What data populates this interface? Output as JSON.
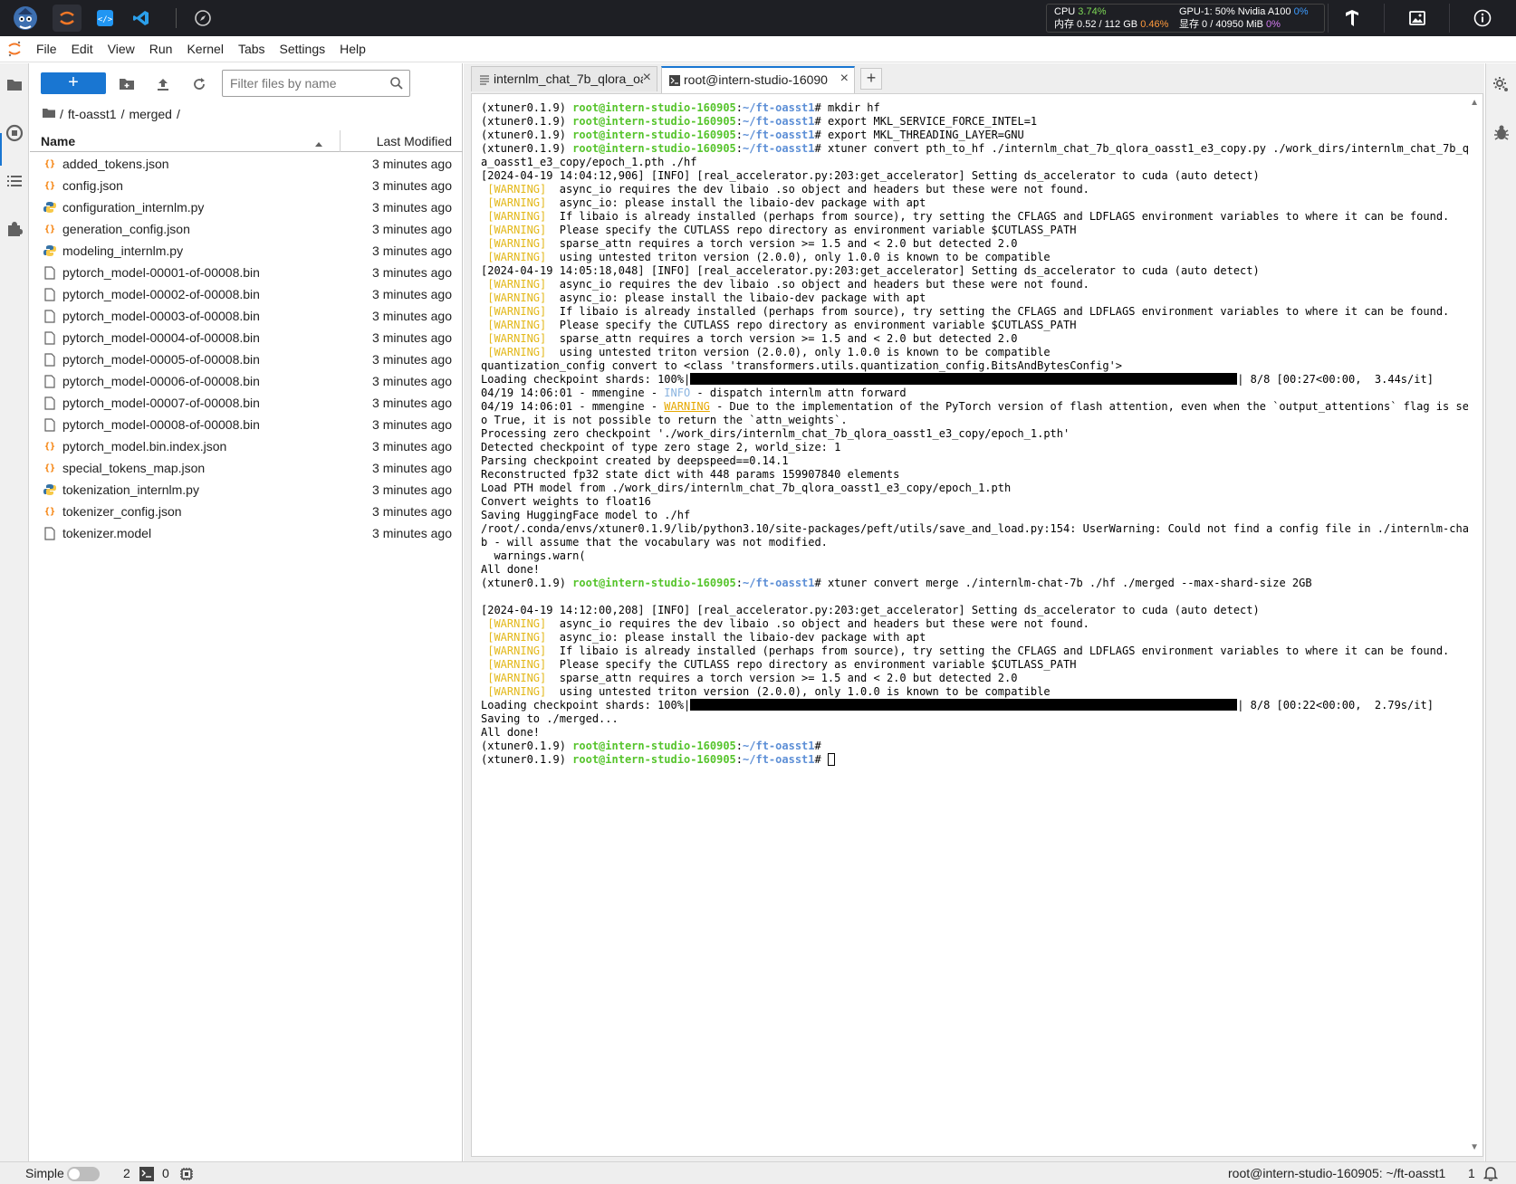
{
  "topbar": {
    "cpu_label": "CPU",
    "cpu_value": "3.74%",
    "mem_label": "内存 0.52 / 112 GB",
    "mem_value": "0.46%",
    "gpu_label": "GPU-1: 50% Nvidia A100",
    "gpu_value": "0%",
    "vram_label": "显存 0 / 40950 MiB",
    "vram_value": "0%"
  },
  "menu": [
    "File",
    "Edit",
    "View",
    "Run",
    "Kernel",
    "Tabs",
    "Settings",
    "Help"
  ],
  "filebrowser": {
    "new_button": "+",
    "filter_placeholder": "Filter files by name",
    "breadcrumb": [
      "/",
      "ft-oasst1",
      "/",
      "merged",
      "/"
    ],
    "col_name": "Name",
    "col_modified": "Last Modified",
    "files": [
      {
        "name": "added_tokens.json",
        "type": "json",
        "modified": "3 minutes ago"
      },
      {
        "name": "config.json",
        "type": "json",
        "modified": "3 minutes ago"
      },
      {
        "name": "configuration_internlm.py",
        "type": "py",
        "modified": "3 minutes ago"
      },
      {
        "name": "generation_config.json",
        "type": "json",
        "modified": "3 minutes ago"
      },
      {
        "name": "modeling_internlm.py",
        "type": "py",
        "modified": "3 minutes ago"
      },
      {
        "name": "pytorch_model-00001-of-00008.bin",
        "type": "file",
        "modified": "3 minutes ago"
      },
      {
        "name": "pytorch_model-00002-of-00008.bin",
        "type": "file",
        "modified": "3 minutes ago"
      },
      {
        "name": "pytorch_model-00003-of-00008.bin",
        "type": "file",
        "modified": "3 minutes ago"
      },
      {
        "name": "pytorch_model-00004-of-00008.bin",
        "type": "file",
        "modified": "3 minutes ago"
      },
      {
        "name": "pytorch_model-00005-of-00008.bin",
        "type": "file",
        "modified": "3 minutes ago"
      },
      {
        "name": "pytorch_model-00006-of-00008.bin",
        "type": "file",
        "modified": "3 minutes ago"
      },
      {
        "name": "pytorch_model-00007-of-00008.bin",
        "type": "file",
        "modified": "3 minutes ago"
      },
      {
        "name": "pytorch_model-00008-of-00008.bin",
        "type": "file",
        "modified": "3 minutes ago"
      },
      {
        "name": "pytorch_model.bin.index.json",
        "type": "json",
        "modified": "3 minutes ago"
      },
      {
        "name": "special_tokens_map.json",
        "type": "json",
        "modified": "3 minutes ago"
      },
      {
        "name": "tokenization_internlm.py",
        "type": "py",
        "modified": "3 minutes ago"
      },
      {
        "name": "tokenizer_config.json",
        "type": "json",
        "modified": "3 minutes ago"
      },
      {
        "name": "tokenizer.model",
        "type": "file",
        "modified": "3 minutes ago"
      }
    ]
  },
  "tabs": [
    {
      "label": "internlm_chat_7b_qlora_oa",
      "close": "×",
      "active": false
    },
    {
      "label": "root@intern-studio-16090",
      "close": "×",
      "active": true
    }
  ],
  "tab_add": "+",
  "terminal": {
    "lines": [
      [
        {
          "t": "(xtuner0.1.9) "
        },
        {
          "t": "root@intern-studio-160905",
          "c": "g"
        },
        {
          "t": ":"
        },
        {
          "t": "~/ft-oasst1",
          "c": "b"
        },
        {
          "t": "# mkdir hf"
        }
      ],
      [
        {
          "t": "(xtuner0.1.9) "
        },
        {
          "t": "root@intern-studio-160905",
          "c": "g"
        },
        {
          "t": ":"
        },
        {
          "t": "~/ft-oasst1",
          "c": "b"
        },
        {
          "t": "# export MKL_SERVICE_FORCE_INTEL=1"
        }
      ],
      [
        {
          "t": "(xtuner0.1.9) "
        },
        {
          "t": "root@intern-studio-160905",
          "c": "g"
        },
        {
          "t": ":"
        },
        {
          "t": "~/ft-oasst1",
          "c": "b"
        },
        {
          "t": "# export MKL_THREADING_LAYER=GNU"
        }
      ],
      [
        {
          "t": "(xtuner0.1.9) "
        },
        {
          "t": "root@intern-studio-160905",
          "c": "g"
        },
        {
          "t": ":"
        },
        {
          "t": "~/ft-oasst1",
          "c": "b"
        },
        {
          "t": "# xtuner convert pth_to_hf ./internlm_chat_7b_qlora_oasst1_e3_copy.py ./work_dirs/internlm_chat_7b_qlor"
        }
      ],
      [
        {
          "t": "a_oasst1_e3_copy/epoch_1.pth ./hf"
        }
      ],
      [
        {
          "t": "[2024-04-19 14:04:12,906] [INFO] [real_accelerator.py:203:get_accelerator] Setting ds_accelerator to cuda (auto detect)"
        }
      ],
      [
        {
          "t": " "
        },
        {
          "t": "[WARNING]",
          "c": "w"
        },
        {
          "t": "  async_io requires the dev libaio .so object and headers but these were not found."
        }
      ],
      [
        {
          "t": " "
        },
        {
          "t": "[WARNING]",
          "c": "w"
        },
        {
          "t": "  async_io: please install the libaio-dev package with apt"
        }
      ],
      [
        {
          "t": " "
        },
        {
          "t": "[WARNING]",
          "c": "w"
        },
        {
          "t": "  If libaio is already installed (perhaps from source), try setting the CFLAGS and LDFLAGS environment variables to where it can be found."
        }
      ],
      [
        {
          "t": " "
        },
        {
          "t": "[WARNING]",
          "c": "w"
        },
        {
          "t": "  Please specify the CUTLASS repo directory as environment variable $CUTLASS_PATH"
        }
      ],
      [
        {
          "t": " "
        },
        {
          "t": "[WARNING]",
          "c": "w"
        },
        {
          "t": "  sparse_attn requires a torch version >= 1.5 and < 2.0 but detected 2.0"
        }
      ],
      [
        {
          "t": " "
        },
        {
          "t": "[WARNING]",
          "c": "w"
        },
        {
          "t": "  using untested triton version (2.0.0), only 1.0.0 is known to be compatible"
        }
      ],
      [
        {
          "t": "[2024-04-19 14:05:18,048] [INFO] [real_accelerator.py:203:get_accelerator] Setting ds_accelerator to cuda (auto detect)"
        }
      ],
      [
        {
          "t": " "
        },
        {
          "t": "[WARNING]",
          "c": "w"
        },
        {
          "t": "  async_io requires the dev libaio .so object and headers but these were not found."
        }
      ],
      [
        {
          "t": " "
        },
        {
          "t": "[WARNING]",
          "c": "w"
        },
        {
          "t": "  async_io: please install the libaio-dev package with apt"
        }
      ],
      [
        {
          "t": " "
        },
        {
          "t": "[WARNING]",
          "c": "w"
        },
        {
          "t": "  If libaio is already installed (perhaps from source), try setting the CFLAGS and LDFLAGS environment variables to where it can be found."
        }
      ],
      [
        {
          "t": " "
        },
        {
          "t": "[WARNING]",
          "c": "w"
        },
        {
          "t": "  Please specify the CUTLASS repo directory as environment variable $CUTLASS_PATH"
        }
      ],
      [
        {
          "t": " "
        },
        {
          "t": "[WARNING]",
          "c": "w"
        },
        {
          "t": "  sparse_attn requires a torch version >= 1.5 and < 2.0 but detected 2.0"
        }
      ],
      [
        {
          "t": " "
        },
        {
          "t": "[WARNING]",
          "c": "w"
        },
        {
          "t": "  using untested triton version (2.0.0), only 1.0.0 is known to be compatible"
        }
      ],
      [
        {
          "t": "quantization_config convert to <class 'transformers.utils.quantization_config.BitsAndBytesConfig'>"
        }
      ],
      [
        {
          "t": "Loading checkpoint shards: 100%|"
        },
        {
          "t": "",
          "c": "bar"
        },
        {
          "t": "| 8/8 [00:27<00:00,  3.44s/it]"
        }
      ],
      [
        {
          "t": "04/19 14:06:01 - mmengine - "
        },
        {
          "t": "INFO",
          "c": "i"
        },
        {
          "t": " - dispatch internlm attn forward"
        }
      ],
      [
        {
          "t": "04/19 14:06:01 - mmengine - "
        },
        {
          "t": "WARNING",
          "c": "wu"
        },
        {
          "t": " - Due to the implementation of the PyTorch version of flash attention, even when the `output_attentions` flag is set t"
        }
      ],
      [
        {
          "t": "o True, it is not possible to return the `attn_weights`."
        }
      ],
      [
        {
          "t": "Processing zero checkpoint './work_dirs/internlm_chat_7b_qlora_oasst1_e3_copy/epoch_1.pth'"
        }
      ],
      [
        {
          "t": "Detected checkpoint of type zero stage 2, world_size: 1"
        }
      ],
      [
        {
          "t": "Parsing checkpoint created by deepspeed==0.14.1"
        }
      ],
      [
        {
          "t": "Reconstructed fp32 state dict with 448 params 159907840 elements"
        }
      ],
      [
        {
          "t": "Load PTH model from ./work_dirs/internlm_chat_7b_qlora_oasst1_e3_copy/epoch_1.pth"
        }
      ],
      [
        {
          "t": "Convert weights to float16"
        }
      ],
      [
        {
          "t": "Saving HuggingFace model to ./hf"
        }
      ],
      [
        {
          "t": "/root/.conda/envs/xtuner0.1.9/lib/python3.10/site-packages/peft/utils/save_and_load.py:154: UserWarning: Could not find a config file in ./internlm-chat-7"
        }
      ],
      [
        {
          "t": "b - will assume that the vocabulary was not modified."
        }
      ],
      [
        {
          "t": "  warnings.warn("
        }
      ],
      [
        {
          "t": "All done!"
        }
      ],
      [
        {
          "t": "(xtuner0.1.9) "
        },
        {
          "t": "root@intern-studio-160905",
          "c": "g"
        },
        {
          "t": ":"
        },
        {
          "t": "~/ft-oasst1",
          "c": "b"
        },
        {
          "t": "# xtuner convert merge ./internlm-chat-7b ./hf ./merged --max-shard-size 2GB"
        }
      ],
      [
        {
          "t": ""
        }
      ],
      [
        {
          "t": "[2024-04-19 14:12:00,208] [INFO] [real_accelerator.py:203:get_accelerator] Setting ds_accelerator to cuda (auto detect)"
        }
      ],
      [
        {
          "t": " "
        },
        {
          "t": "[WARNING]",
          "c": "w"
        },
        {
          "t": "  async_io requires the dev libaio .so object and headers but these were not found."
        }
      ],
      [
        {
          "t": " "
        },
        {
          "t": "[WARNING]",
          "c": "w"
        },
        {
          "t": "  async_io: please install the libaio-dev package with apt"
        }
      ],
      [
        {
          "t": " "
        },
        {
          "t": "[WARNING]",
          "c": "w"
        },
        {
          "t": "  If libaio is already installed (perhaps from source), try setting the CFLAGS and LDFLAGS environment variables to where it can be found."
        }
      ],
      [
        {
          "t": " "
        },
        {
          "t": "[WARNING]",
          "c": "w"
        },
        {
          "t": "  Please specify the CUTLASS repo directory as environment variable $CUTLASS_PATH"
        }
      ],
      [
        {
          "t": " "
        },
        {
          "t": "[WARNING]",
          "c": "w"
        },
        {
          "t": "  sparse_attn requires a torch version >= 1.5 and < 2.0 but detected 2.0"
        }
      ],
      [
        {
          "t": " "
        },
        {
          "t": "[WARNING]",
          "c": "w"
        },
        {
          "t": "  using untested triton version (2.0.0), only 1.0.0 is known to be compatible"
        }
      ],
      [
        {
          "t": "Loading checkpoint shards: 100%|"
        },
        {
          "t": "",
          "c": "bar"
        },
        {
          "t": "| 8/8 [00:22<00:00,  2.79s/it]"
        }
      ],
      [
        {
          "t": "Saving to ./merged..."
        }
      ],
      [
        {
          "t": "All done!"
        }
      ],
      [
        {
          "t": "(xtuner0.1.9) "
        },
        {
          "t": "root@intern-studio-160905",
          "c": "g"
        },
        {
          "t": ":"
        },
        {
          "t": "~/ft-oasst1",
          "c": "b"
        },
        {
          "t": "#"
        }
      ],
      [
        {
          "t": "(xtuner0.1.9) "
        },
        {
          "t": "root@intern-studio-160905",
          "c": "g"
        },
        {
          "t": ":"
        },
        {
          "t": "~/ft-oasst1",
          "c": "b"
        },
        {
          "t": "# "
        },
        {
          "t": "",
          "c": "cursor"
        }
      ]
    ]
  },
  "statusbar": {
    "mode_label": "Simple",
    "kernels_count": "2",
    "terminals_count": "0",
    "right_text": "root@intern-studio-160905: ~/ft-oasst1",
    "right_num": "1"
  },
  "colors": {
    "accent": "#1976d2",
    "prompt_user": "#56c42c",
    "prompt_path": "#5d8fd6",
    "warning": "#e3b81a",
    "topbar_bg": "#1e1f24"
  }
}
